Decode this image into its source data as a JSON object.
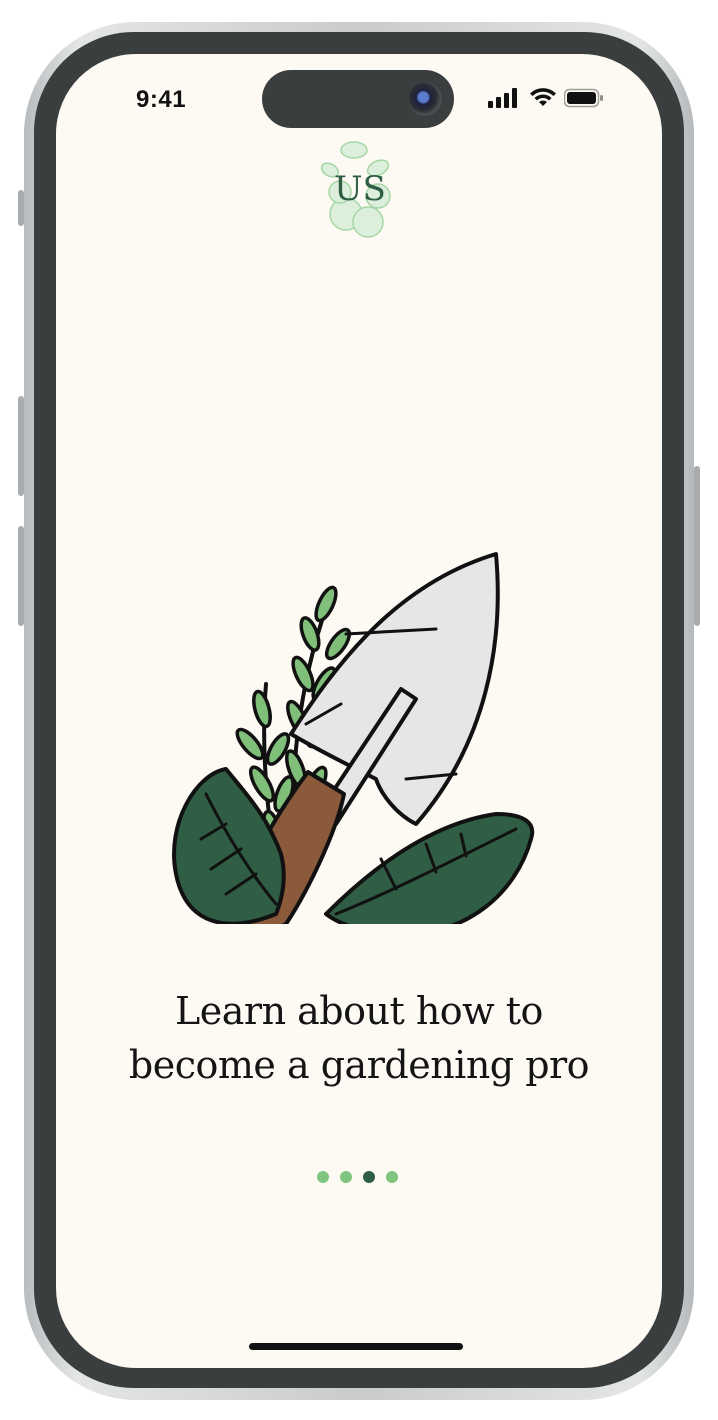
{
  "status_bar": {
    "time": "9:41",
    "icons": [
      "cellular-signal-icon",
      "wifi-icon",
      "battery-icon"
    ]
  },
  "logo": {
    "text": "US",
    "icon": "veggie-logo-icon"
  },
  "illustration": {
    "icon": "garden-trowel-with-plants-icon"
  },
  "headline": {
    "line1": "Learn about how to",
    "line2": "become a gardening pro"
  },
  "pagination": {
    "total": 4,
    "active_index": 2
  },
  "colors": {
    "background": "#fdfaf3",
    "dot_inactive": "#7fc47f",
    "dot_active": "#2f5e45",
    "leaf_dark": "#2f5e45",
    "leaf_light": "#7fbf7a",
    "handle": "#8a5a3a",
    "blade": "#e6e6e6"
  }
}
